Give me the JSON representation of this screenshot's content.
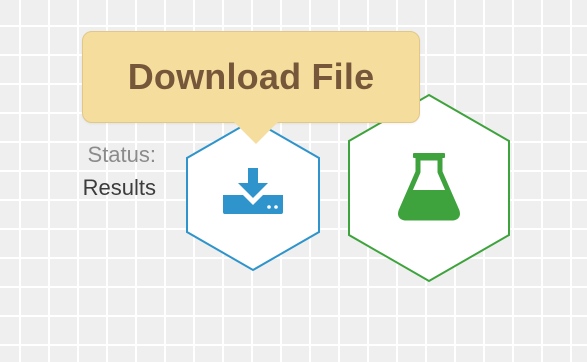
{
  "status": {
    "label": "Status:",
    "value": "Results"
  },
  "tooltip": {
    "text": "Download File"
  },
  "nodes": [
    {
      "name": "download-file",
      "icon": "download-icon",
      "color": "#2e94cb"
    },
    {
      "name": "results",
      "icon": "flask-icon",
      "color": "#3ea33c"
    }
  ],
  "colors": {
    "tooltip_bg": "#f5de9d",
    "tooltip_text": "#77573a",
    "canvas_bg": "#eeefee",
    "grid": "#ffffff"
  }
}
